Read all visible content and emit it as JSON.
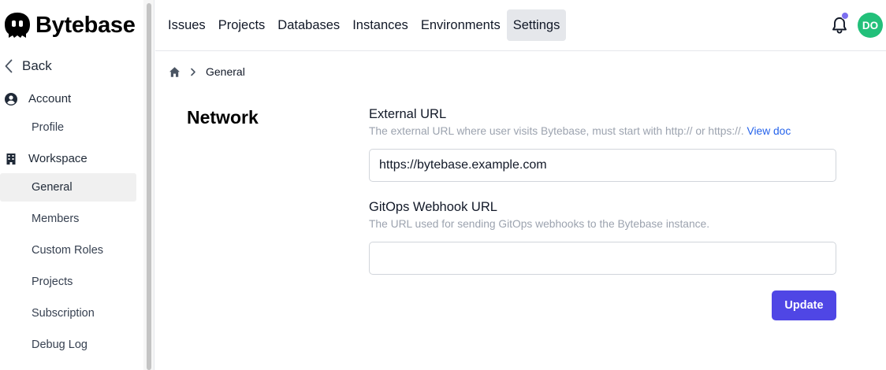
{
  "app": {
    "name": "Bytebase"
  },
  "sidebar": {
    "back_label": "Back",
    "account": {
      "label": "Account",
      "items": [
        {
          "label": "Profile"
        }
      ]
    },
    "workspace": {
      "label": "Workspace",
      "items": [
        {
          "label": "General",
          "active": true
        },
        {
          "label": "Members"
        },
        {
          "label": "Custom Roles"
        },
        {
          "label": "Projects"
        },
        {
          "label": "Subscription"
        },
        {
          "label": "Debug Log"
        }
      ]
    }
  },
  "topnav": {
    "items": [
      {
        "label": "Issues"
      },
      {
        "label": "Projects"
      },
      {
        "label": "Databases"
      },
      {
        "label": "Instances"
      },
      {
        "label": "Environments"
      },
      {
        "label": "Settings",
        "active": true
      }
    ],
    "avatar_initials": "DO",
    "notification_dot": true
  },
  "breadcrumb": {
    "current": "General"
  },
  "main": {
    "section_title": "Network",
    "external_url": {
      "label": "External URL",
      "description": "The external URL where user visits Bytebase, must start with http:// or https://.",
      "link_text": "View doc",
      "value": "https://bytebase.example.com",
      "placeholder": ""
    },
    "gitops": {
      "label": "GitOps Webhook URL",
      "description": "The URL used for sending GitOps webhooks to the Bytebase instance.",
      "value": "",
      "placeholder": ""
    },
    "update_label": "Update"
  },
  "colors": {
    "accent": "#4f46e5",
    "avatar": "#22c07a",
    "notification_dot": "#7c6ff0",
    "link": "#2563eb"
  }
}
